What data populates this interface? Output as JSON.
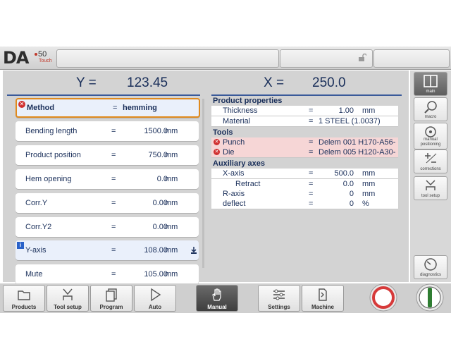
{
  "logo": {
    "brand": "DA",
    "model": "50",
    "edition": "Touch"
  },
  "header": {
    "y_label": "Y =",
    "y_value": "123.45",
    "x_label": "X =",
    "x_value": "250.0"
  },
  "params": [
    {
      "label": "Method",
      "eq": "=",
      "value": "hemming",
      "unit": ""
    },
    {
      "label": "Bending length",
      "eq": "=",
      "value": "1500.0",
      "unit": "mm"
    },
    {
      "label": "Product position",
      "eq": "=",
      "value": "750.0",
      "unit": "mm"
    },
    {
      "label": "Hem opening",
      "eq": "=",
      "value": "0.0",
      "unit": "mm"
    },
    {
      "label": "Corr.Y",
      "eq": "=",
      "value": "0.00",
      "unit": "mm"
    },
    {
      "label": "Corr.Y2",
      "eq": "=",
      "value": "0.00",
      "unit": "mm"
    },
    {
      "label": "Y-axis",
      "eq": "=",
      "value": "108.00",
      "unit": "mm"
    },
    {
      "label": "Mute",
      "eq": "=",
      "value": "105.00",
      "unit": "mm"
    }
  ],
  "product_properties": {
    "title": "Product properties",
    "rows": [
      {
        "label": "Thickness",
        "eq": "=",
        "value": "1.00",
        "unit": "mm"
      },
      {
        "label": "Material",
        "eq": "=",
        "value": "1 STEEL (1.0037)",
        "unit": ""
      }
    ]
  },
  "tools": {
    "title": "Tools",
    "rows": [
      {
        "label": "Punch",
        "eq": "=",
        "value": "Delem 001 H170-A56-"
      },
      {
        "label": "Die",
        "eq": "=",
        "value": "Delem 005 H120-A30-"
      }
    ]
  },
  "auxiliary_axes": {
    "title": "Auxiliary axes",
    "rows": [
      {
        "label": "X-axis",
        "eq": "=",
        "value": "500.0",
        "unit": "mm"
      },
      {
        "label": "Retract",
        "eq": "=",
        "value": "0.0",
        "unit": "mm"
      },
      {
        "label": "R-axis",
        "eq": "=",
        "value": "0",
        "unit": "mm"
      },
      {
        "label": "deflect",
        "eq": "=",
        "value": "0",
        "unit": "%"
      }
    ]
  },
  "sidebar": {
    "items": [
      {
        "label": "main",
        "icon": "split-view-icon"
      },
      {
        "label": "macro",
        "icon": "magnifier-icon"
      },
      {
        "label": "manual positioning",
        "icon": "gauge-icon"
      },
      {
        "label": "corrections",
        "icon": "plus-minus-icon"
      },
      {
        "label": "tool setup",
        "icon": "tool-icon"
      },
      {
        "label": "diagnostics",
        "icon": "dial-icon"
      }
    ]
  },
  "bottom_nav": {
    "items": [
      "Products",
      "Tool setup",
      "Program",
      "Auto",
      "Manual",
      "Settings",
      "Machine"
    ]
  },
  "colors": {
    "accent": "#1a2f5a",
    "selected_border": "#e08a1e",
    "error": "#d03030",
    "stop": "#d63a3a",
    "start": "#2f7d32"
  }
}
